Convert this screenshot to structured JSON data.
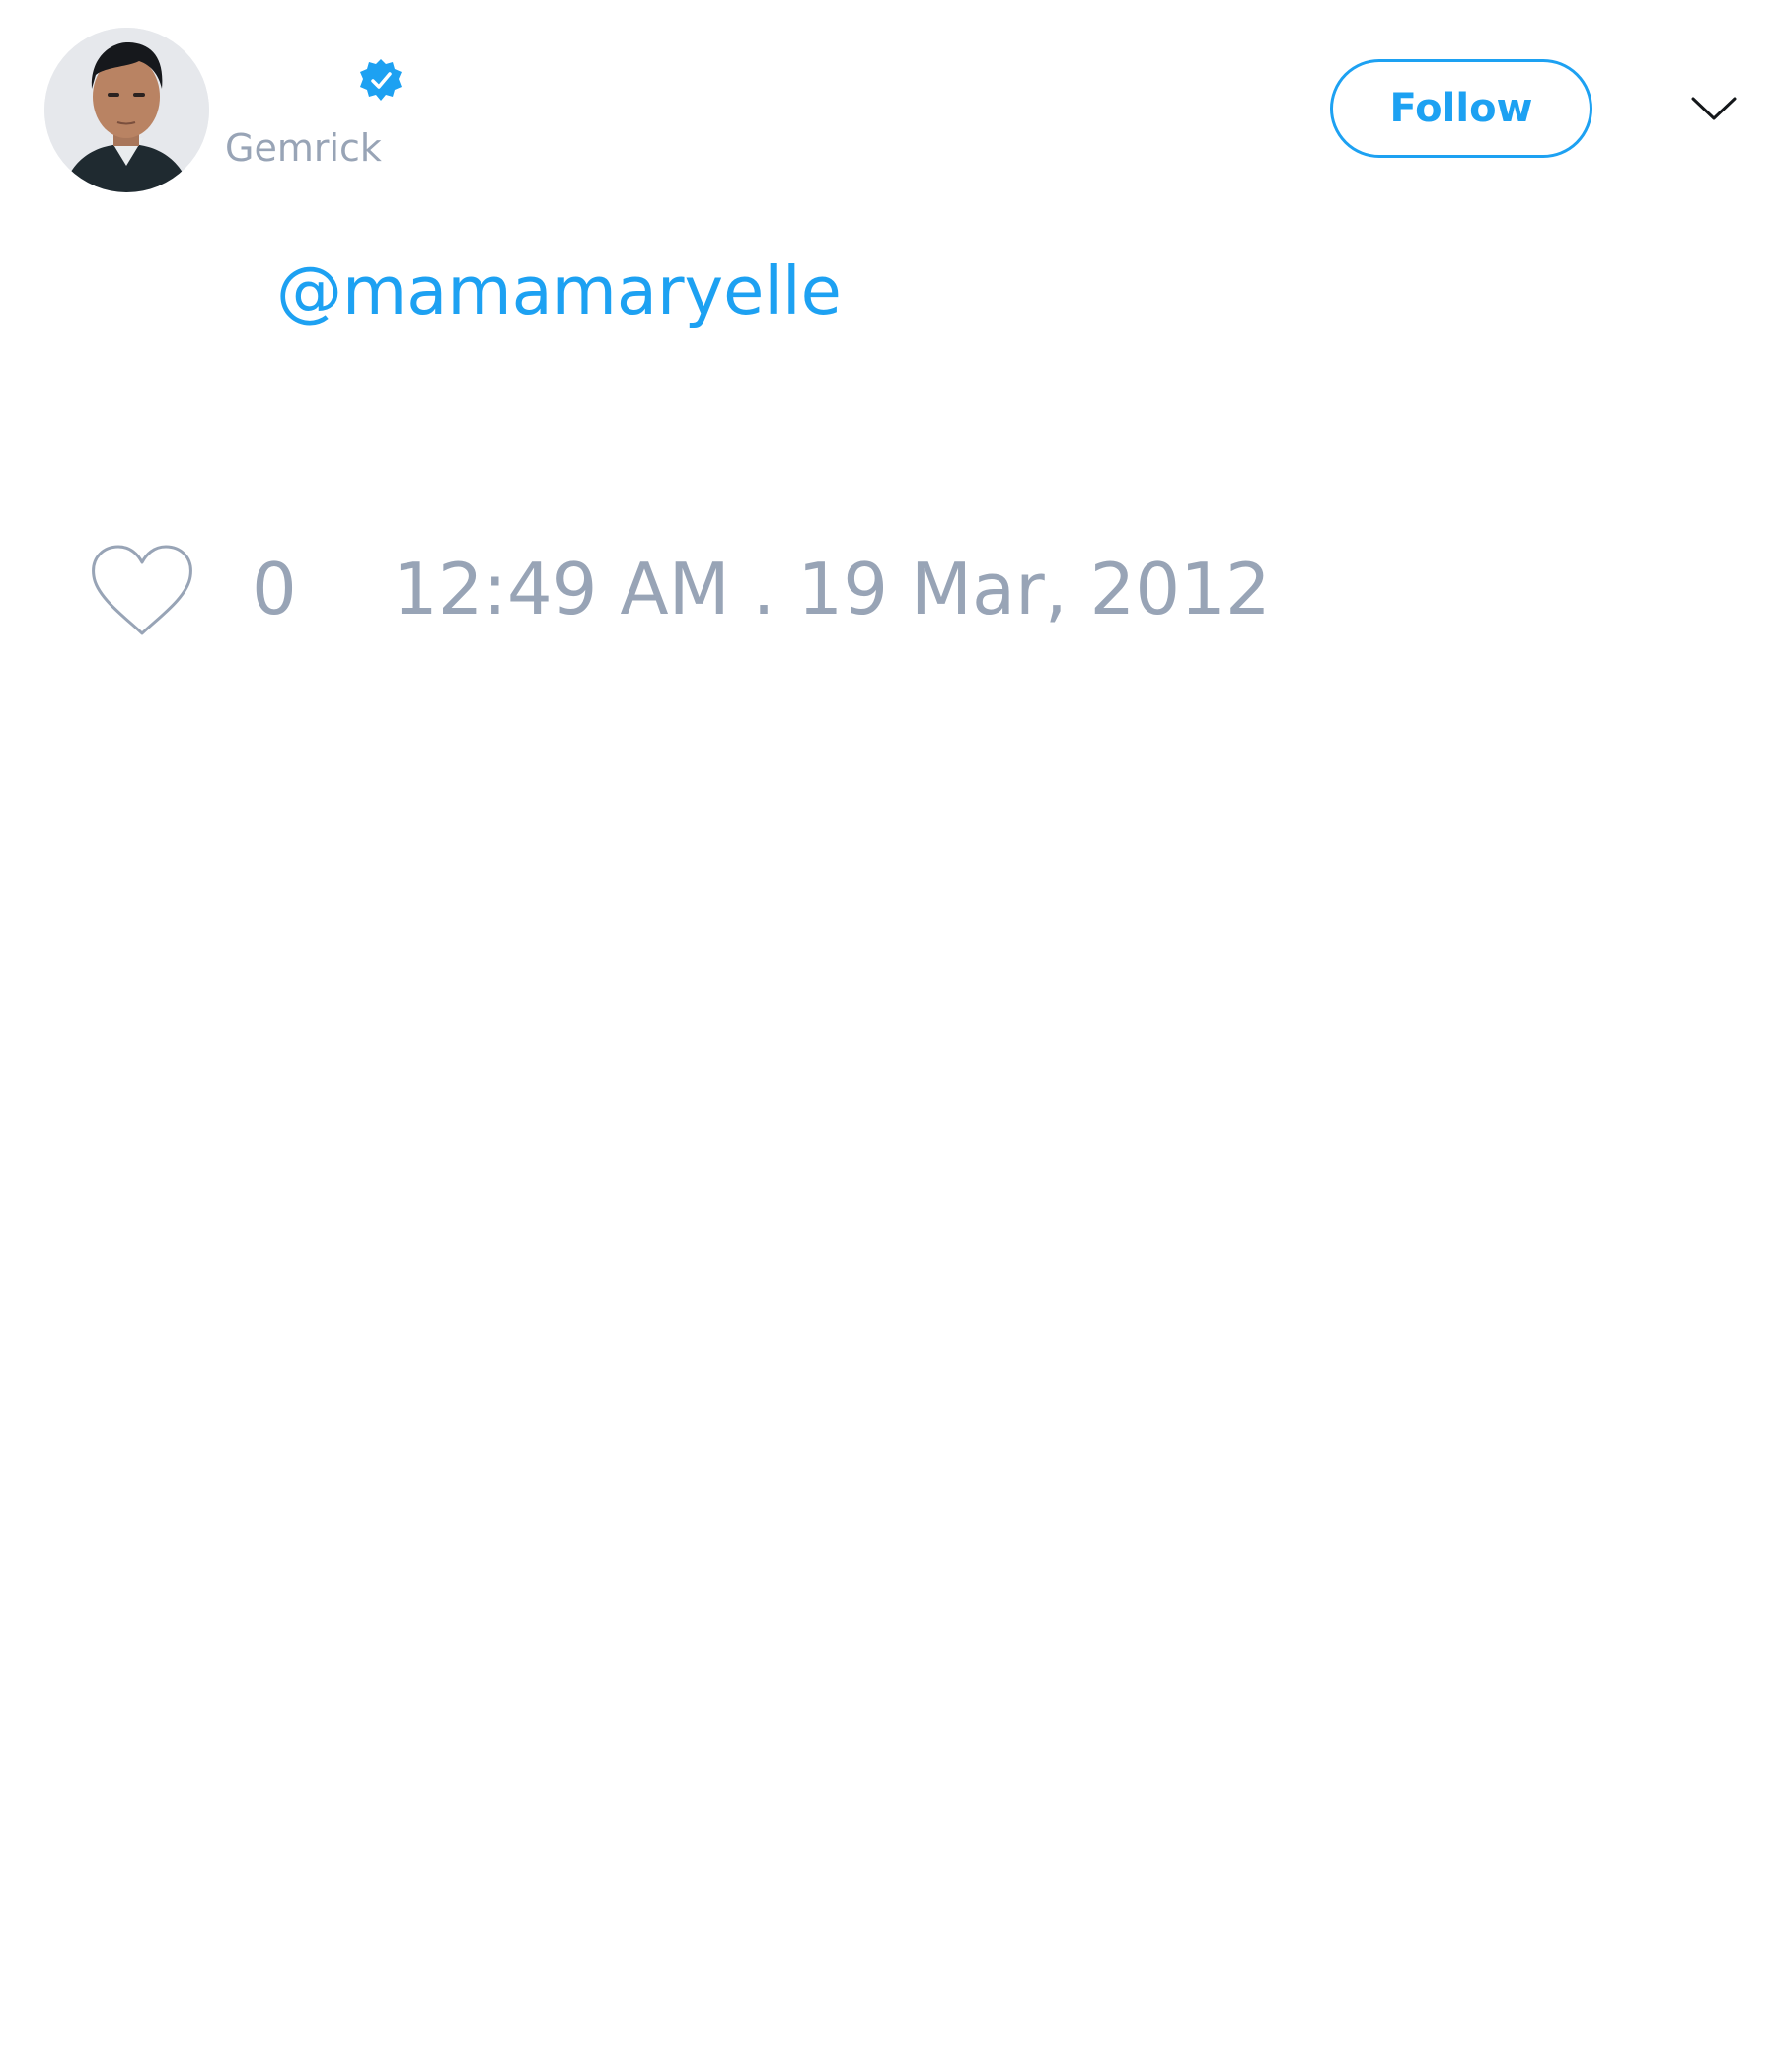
{
  "user": {
    "display_name": "",
    "screen_name": "Gemrick",
    "verified": true
  },
  "header": {
    "follow_label": "Follow"
  },
  "tweet": {
    "mention": "@mamamaryelle"
  },
  "footer": {
    "like_count": "0",
    "timestamp": "12:49 AM . 19 Mar, 2012"
  },
  "colors": {
    "accent": "#1da1f2",
    "muted_text": "#98a4b6",
    "background": "#ffffff"
  },
  "icons": [
    "verified-badge-icon",
    "chevron-down-icon",
    "heart-icon"
  ]
}
